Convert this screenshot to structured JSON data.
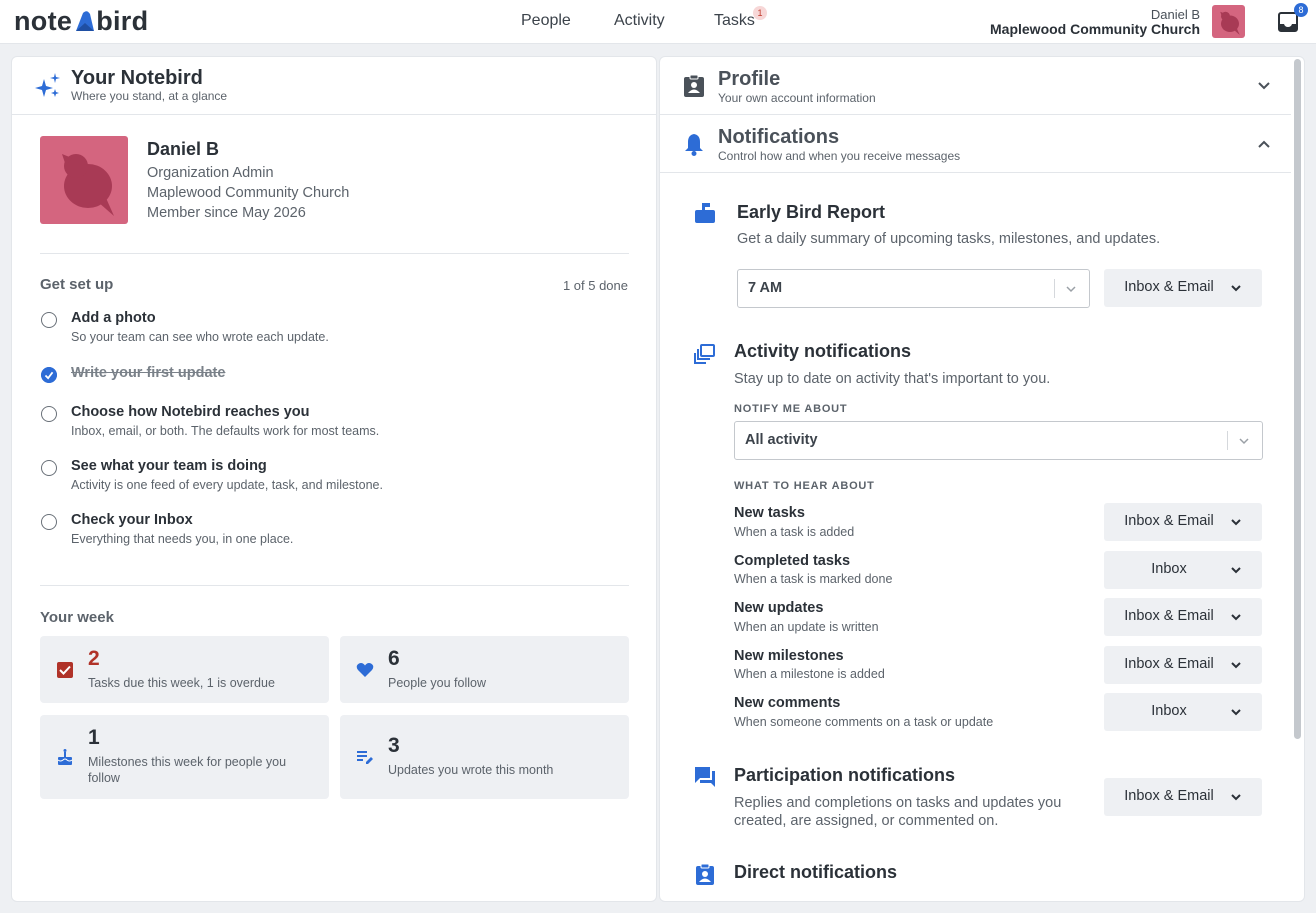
{
  "brand": {
    "logo_left": "note",
    "logo_right": "bird",
    "accent": "#2d6cd6",
    "avatar_color": "#d4657f"
  },
  "nav": {
    "people": "People",
    "activity": "Activity",
    "tasks": "Tasks",
    "tasks_badge": "1"
  },
  "user": {
    "name": "Daniel B",
    "org": "Maplewood Community Church",
    "inbox_badge": "8"
  },
  "left": {
    "title": "Your Notebird",
    "subtitle": "Where you stand, at a glance",
    "profile": {
      "name": "Daniel B",
      "role": "Organization Admin",
      "org": "Maplewood Community Church",
      "since": "Member since May 2026"
    },
    "setup": {
      "title": "Get set up",
      "count": "1 of 5 done",
      "items": [
        {
          "title": "Add a photo",
          "sub": "So your team can see who wrote each update.",
          "done": false
        },
        {
          "title": "Write your first update",
          "sub": "",
          "done": true
        },
        {
          "title": "Choose how Notebird reaches you",
          "sub": "Inbox, email, or both. The defaults work for most teams.",
          "done": false
        },
        {
          "title": "See what your team is doing",
          "sub": "Activity is one feed of every update, task, and milestone.",
          "done": false
        },
        {
          "title": "Check your Inbox",
          "sub": "Everything that needs you, in one place.",
          "done": false
        }
      ]
    },
    "week": {
      "title": "Your week",
      "stats": [
        {
          "num": "2",
          "label": "Tasks due this week, 1 is overdue",
          "icon": "checkbox-icon"
        },
        {
          "num": "6",
          "label": "People you follow",
          "icon": "heart-icon"
        },
        {
          "num": "1",
          "label": "Milestones this week for people you follow",
          "icon": "cake-icon"
        },
        {
          "num": "3",
          "label": "Updates you wrote this month",
          "icon": "edit-list-icon"
        }
      ]
    }
  },
  "right": {
    "profile": {
      "title": "Profile",
      "subtitle": "Your own account information"
    },
    "notifications": {
      "title": "Notifications",
      "subtitle": "Control how and when you receive messages"
    },
    "early_bird": {
      "title": "Early Bird Report",
      "desc": "Get a daily summary of upcoming tasks, milestones, and updates.",
      "time": "7 AM",
      "channel": "Inbox & Email"
    },
    "activity": {
      "title": "Activity notifications",
      "desc": "Stay up to date on activity that's important to you.",
      "notify_label": "NOTIFY ME ABOUT",
      "notify_value": "All activity",
      "hear_label": "WHAT TO HEAR ABOUT",
      "prefs": [
        {
          "title": "New tasks",
          "sub": "When a task is added",
          "channel": "Inbox & Email"
        },
        {
          "title": "Completed tasks",
          "sub": "When a task is marked done",
          "channel": "Inbox"
        },
        {
          "title": "New updates",
          "sub": "When an update is written",
          "channel": "Inbox & Email"
        },
        {
          "title": "New milestones",
          "sub": "When a milestone is added",
          "channel": "Inbox & Email"
        },
        {
          "title": "New comments",
          "sub": "When someone comments on a task or update",
          "channel": "Inbox"
        }
      ]
    },
    "participation": {
      "title": "Participation notifications",
      "desc_1": "Replies and completions on tasks and updates you",
      "desc_2": "created, are assigned, or commented on.",
      "channel": "Inbox & Email"
    },
    "direct": {
      "title": "Direct notifications"
    }
  }
}
